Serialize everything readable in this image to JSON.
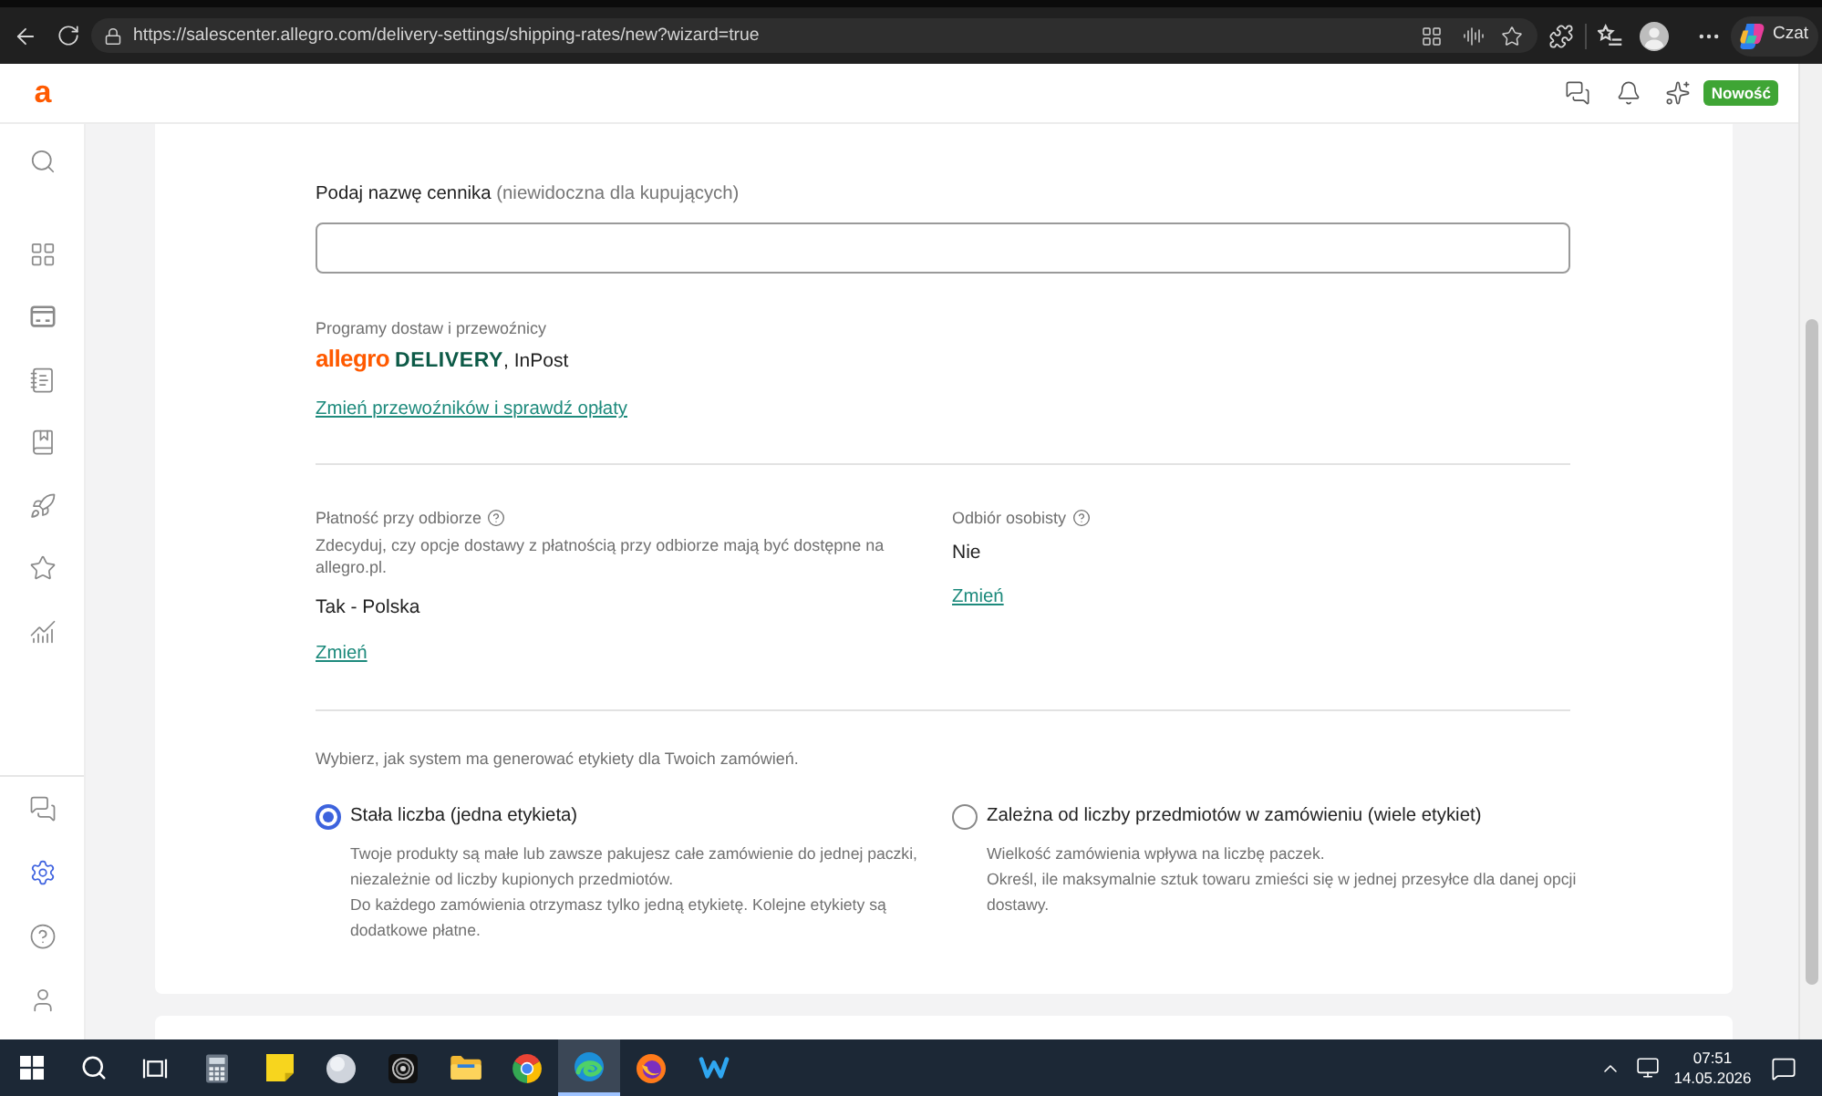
{
  "browser": {
    "url": "https://salescenter.allegro.com/delivery-settings/shipping-rates/new?wizard=true",
    "chat_label": "Czat"
  },
  "header": {
    "logo": "a",
    "badge": "Nowość"
  },
  "sidebar": {
    "top_items": [
      {
        "kind": "search",
        "selected": false
      },
      {
        "kind": "grid",
        "selected": false
      },
      {
        "kind": "tray",
        "selected": false
      },
      {
        "kind": "notepad",
        "selected": false
      },
      {
        "kind": "book",
        "selected": false
      },
      {
        "kind": "rocket",
        "selected": false
      },
      {
        "kind": "star",
        "selected": false
      },
      {
        "kind": "chart",
        "selected": false
      }
    ],
    "bottom_items": [
      {
        "kind": "chat",
        "selected": false
      },
      {
        "kind": "gear",
        "selected": true
      },
      {
        "kind": "help",
        "selected": false
      },
      {
        "kind": "person",
        "selected": false
      }
    ]
  },
  "form": {
    "name_field": {
      "label": "Podaj nazwę cennika",
      "label_note": "(niewidoczna dla kupujących)"
    },
    "carriers": {
      "label": "Programy dostaw i przewoźnicy",
      "logo_brand": "allegro",
      "logo_program": "DELIVERY",
      "others": ", InPost",
      "link": "Zmień przewoźników i sprawdź opłaty"
    },
    "cash_on_delivery": {
      "label": "Płatność przy odbiorze",
      "description": "Zdecyduj, czy opcje dostawy z płatnością przy odbiorze mają być dostępne na allegro.pl.",
      "value": "Tak - Polska",
      "link": "Zmień"
    },
    "personal_pickup": {
      "label": "Odbiór osobisty",
      "value": "Nie",
      "link": "Zmień"
    },
    "shipping_labels": {
      "prompt": "Wybierz, jak system ma generować etykiety dla Twoich zamówień.",
      "options": [
        {
          "label": "Stała liczba (jedna etykieta)",
          "selected": true,
          "description": [
            "Twoje produkty są małe lub zawsze pakujesz całe zamówienie do jednej paczki, niezależnie od liczby kupionych przedmiotów.",
            "Do każdego zamówienia otrzymasz tylko jedną etykietę. Kolejne etykiety są dodatkowe płatne."
          ]
        },
        {
          "label": "Zależna od liczby przedmiotów w zamówieniu (wiele etykiet)",
          "selected": false,
          "description": [
            "Wielkość zamówienia wpływa na liczbę paczek.",
            "Określ, ile maksymalnie sztuk towaru zmieści się w jednej przesyłce dla danej opcji dostawy."
          ]
        }
      ]
    }
  },
  "taskbar": {
    "apps": [
      {
        "kind": "calculator",
        "selected": false
      },
      {
        "kind": "note",
        "selected": false
      },
      {
        "kind": "sphere",
        "selected": false
      },
      {
        "kind": "lens",
        "selected": false
      },
      {
        "kind": "folder",
        "selected": false
      },
      {
        "kind": "tricolor",
        "selected": false
      },
      {
        "kind": "swirl",
        "selected": true
      },
      {
        "kind": "flame",
        "selected": false
      },
      {
        "kind": "zigzag",
        "selected": false
      }
    ],
    "time": "07:51",
    "date": "14.05.2026"
  }
}
